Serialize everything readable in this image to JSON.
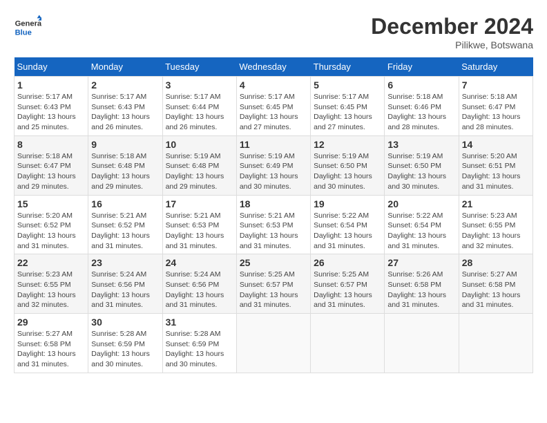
{
  "header": {
    "logo_general": "General",
    "logo_blue": "Blue",
    "month": "December 2024",
    "location": "Pilikwe, Botswana"
  },
  "days_of_week": [
    "Sunday",
    "Monday",
    "Tuesday",
    "Wednesday",
    "Thursday",
    "Friday",
    "Saturday"
  ],
  "weeks": [
    [
      {
        "day": "1",
        "info": "Sunrise: 5:17 AM\nSunset: 6:43 PM\nDaylight: 13 hours\nand 25 minutes."
      },
      {
        "day": "2",
        "info": "Sunrise: 5:17 AM\nSunset: 6:43 PM\nDaylight: 13 hours\nand 26 minutes."
      },
      {
        "day": "3",
        "info": "Sunrise: 5:17 AM\nSunset: 6:44 PM\nDaylight: 13 hours\nand 26 minutes."
      },
      {
        "day": "4",
        "info": "Sunrise: 5:17 AM\nSunset: 6:45 PM\nDaylight: 13 hours\nand 27 minutes."
      },
      {
        "day": "5",
        "info": "Sunrise: 5:17 AM\nSunset: 6:45 PM\nDaylight: 13 hours\nand 27 minutes."
      },
      {
        "day": "6",
        "info": "Sunrise: 5:18 AM\nSunset: 6:46 PM\nDaylight: 13 hours\nand 28 minutes."
      },
      {
        "day": "7",
        "info": "Sunrise: 5:18 AM\nSunset: 6:47 PM\nDaylight: 13 hours\nand 28 minutes."
      }
    ],
    [
      {
        "day": "8",
        "info": "Sunrise: 5:18 AM\nSunset: 6:47 PM\nDaylight: 13 hours\nand 29 minutes."
      },
      {
        "day": "9",
        "info": "Sunrise: 5:18 AM\nSunset: 6:48 PM\nDaylight: 13 hours\nand 29 minutes."
      },
      {
        "day": "10",
        "info": "Sunrise: 5:19 AM\nSunset: 6:48 PM\nDaylight: 13 hours\nand 29 minutes."
      },
      {
        "day": "11",
        "info": "Sunrise: 5:19 AM\nSunset: 6:49 PM\nDaylight: 13 hours\nand 30 minutes."
      },
      {
        "day": "12",
        "info": "Sunrise: 5:19 AM\nSunset: 6:50 PM\nDaylight: 13 hours\nand 30 minutes."
      },
      {
        "day": "13",
        "info": "Sunrise: 5:19 AM\nSunset: 6:50 PM\nDaylight: 13 hours\nand 30 minutes."
      },
      {
        "day": "14",
        "info": "Sunrise: 5:20 AM\nSunset: 6:51 PM\nDaylight: 13 hours\nand 31 minutes."
      }
    ],
    [
      {
        "day": "15",
        "info": "Sunrise: 5:20 AM\nSunset: 6:52 PM\nDaylight: 13 hours\nand 31 minutes."
      },
      {
        "day": "16",
        "info": "Sunrise: 5:21 AM\nSunset: 6:52 PM\nDaylight: 13 hours\nand 31 minutes."
      },
      {
        "day": "17",
        "info": "Sunrise: 5:21 AM\nSunset: 6:53 PM\nDaylight: 13 hours\nand 31 minutes."
      },
      {
        "day": "18",
        "info": "Sunrise: 5:21 AM\nSunset: 6:53 PM\nDaylight: 13 hours\nand 31 minutes."
      },
      {
        "day": "19",
        "info": "Sunrise: 5:22 AM\nSunset: 6:54 PM\nDaylight: 13 hours\nand 31 minutes."
      },
      {
        "day": "20",
        "info": "Sunrise: 5:22 AM\nSunset: 6:54 PM\nDaylight: 13 hours\nand 31 minutes."
      },
      {
        "day": "21",
        "info": "Sunrise: 5:23 AM\nSunset: 6:55 PM\nDaylight: 13 hours\nand 32 minutes."
      }
    ],
    [
      {
        "day": "22",
        "info": "Sunrise: 5:23 AM\nSunset: 6:55 PM\nDaylight: 13 hours\nand 32 minutes."
      },
      {
        "day": "23",
        "info": "Sunrise: 5:24 AM\nSunset: 6:56 PM\nDaylight: 13 hours\nand 31 minutes."
      },
      {
        "day": "24",
        "info": "Sunrise: 5:24 AM\nSunset: 6:56 PM\nDaylight: 13 hours\nand 31 minutes."
      },
      {
        "day": "25",
        "info": "Sunrise: 5:25 AM\nSunset: 6:57 PM\nDaylight: 13 hours\nand 31 minutes."
      },
      {
        "day": "26",
        "info": "Sunrise: 5:25 AM\nSunset: 6:57 PM\nDaylight: 13 hours\nand 31 minutes."
      },
      {
        "day": "27",
        "info": "Sunrise: 5:26 AM\nSunset: 6:58 PM\nDaylight: 13 hours\nand 31 minutes."
      },
      {
        "day": "28",
        "info": "Sunrise: 5:27 AM\nSunset: 6:58 PM\nDaylight: 13 hours\nand 31 minutes."
      }
    ],
    [
      {
        "day": "29",
        "info": "Sunrise: 5:27 AM\nSunset: 6:58 PM\nDaylight: 13 hours\nand 31 minutes."
      },
      {
        "day": "30",
        "info": "Sunrise: 5:28 AM\nSunset: 6:59 PM\nDaylight: 13 hours\nand 30 minutes."
      },
      {
        "day": "31",
        "info": "Sunrise: 5:28 AM\nSunset: 6:59 PM\nDaylight: 13 hours\nand 30 minutes."
      },
      null,
      null,
      null,
      null
    ]
  ]
}
